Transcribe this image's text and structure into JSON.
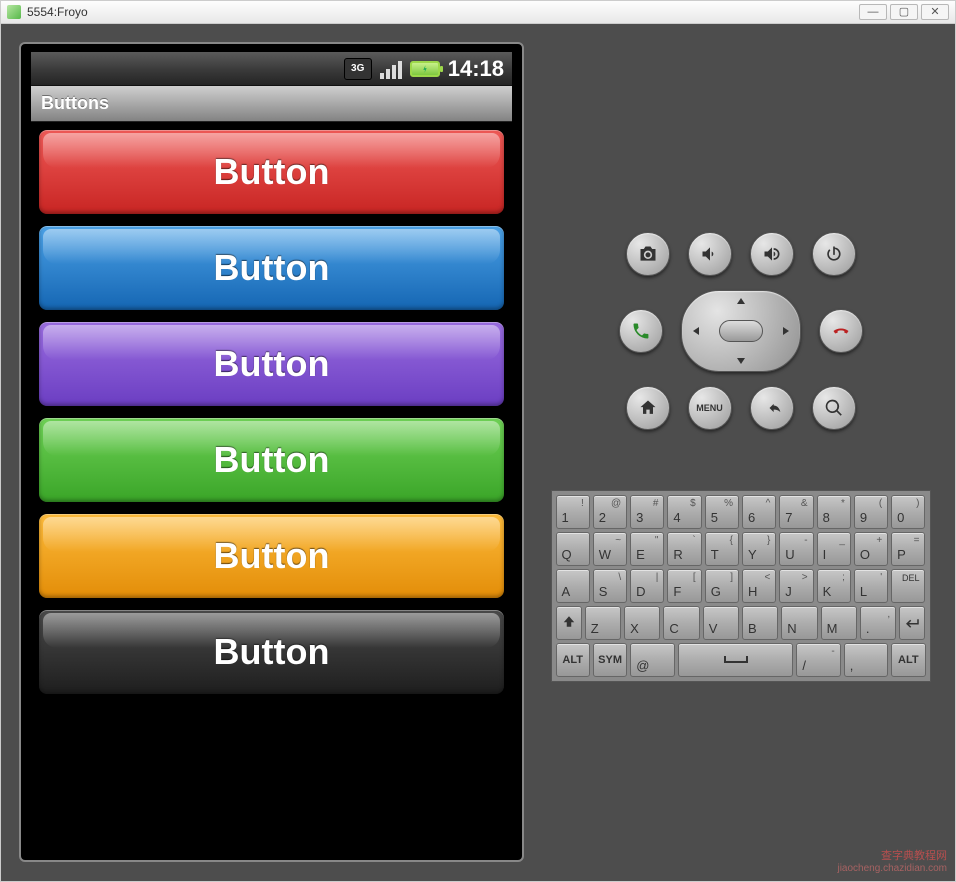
{
  "window": {
    "title": "5554:Froyo"
  },
  "statusbar": {
    "icon_3g": "3G",
    "time": "14:18"
  },
  "app": {
    "title": "Buttons"
  },
  "buttons": [
    {
      "label": "Button",
      "bg": "linear-gradient(#ef5a57,#c82523)",
      "name": "app-button-red"
    },
    {
      "label": "Button",
      "bg": "linear-gradient(#4ca2e7,#1566b3)",
      "name": "app-button-blue"
    },
    {
      "label": "Button",
      "bg": "linear-gradient(#9a6de0,#6b3ec2)",
      "name": "app-button-purple"
    },
    {
      "label": "Button",
      "bg": "linear-gradient(#6fd156,#3aa528)",
      "name": "app-button-green"
    },
    {
      "label": "Button",
      "bg": "linear-gradient(#fdbb3b,#e38d08)",
      "name": "app-button-orange"
    },
    {
      "label": "Button",
      "bg": "linear-gradient(#4a4a4a,#1e1e1e)",
      "name": "app-button-black"
    }
  ],
  "controls": {
    "menu_label": "MENU"
  },
  "keyboard": {
    "row1": [
      {
        "m": "1",
        "s": "!"
      },
      {
        "m": "2",
        "s": "@"
      },
      {
        "m": "3",
        "s": "#"
      },
      {
        "m": "4",
        "s": "$"
      },
      {
        "m": "5",
        "s": "%"
      },
      {
        "m": "6",
        "s": "^"
      },
      {
        "m": "7",
        "s": "&"
      },
      {
        "m": "8",
        "s": "*"
      },
      {
        "m": "9",
        "s": "("
      },
      {
        "m": "0",
        "s": ")"
      }
    ],
    "row2": [
      {
        "m": "Q",
        "s": ""
      },
      {
        "m": "W",
        "s": "~"
      },
      {
        "m": "E",
        "s": "\""
      },
      {
        "m": "R",
        "s": "`"
      },
      {
        "m": "T",
        "s": "{"
      },
      {
        "m": "Y",
        "s": "}"
      },
      {
        "m": "U",
        "s": "-"
      },
      {
        "m": "I",
        "s": "_"
      },
      {
        "m": "O",
        "s": "+"
      },
      {
        "m": "P",
        "s": "="
      }
    ],
    "row3": [
      {
        "m": "A",
        "s": ""
      },
      {
        "m": "S",
        "s": "\\"
      },
      {
        "m": "D",
        "s": "|"
      },
      {
        "m": "F",
        "s": "["
      },
      {
        "m": "G",
        "s": "]"
      },
      {
        "m": "H",
        "s": "<"
      },
      {
        "m": "J",
        "s": ">"
      },
      {
        "m": "K",
        "s": ";"
      },
      {
        "m": "L",
        "s": "'"
      }
    ],
    "row3_del": "DEL",
    "row4": [
      {
        "m": "Z",
        "s": ""
      },
      {
        "m": "X",
        "s": ""
      },
      {
        "m": "C",
        "s": ""
      },
      {
        "m": "V",
        "s": ""
      },
      {
        "m": "B",
        "s": ""
      },
      {
        "m": "N",
        "s": ""
      },
      {
        "m": "M",
        "s": ""
      },
      {
        "m": ".",
        "s": ","
      }
    ],
    "row5_alt": "ALT",
    "row5_sym": "SYM",
    "row5_at": "@",
    "row5_slash": "/",
    "row5_comma": ",",
    "row5_dash": "-"
  },
  "watermark": {
    "text": "查字典教程网",
    "url": "jiaocheng.chazidian.com"
  }
}
